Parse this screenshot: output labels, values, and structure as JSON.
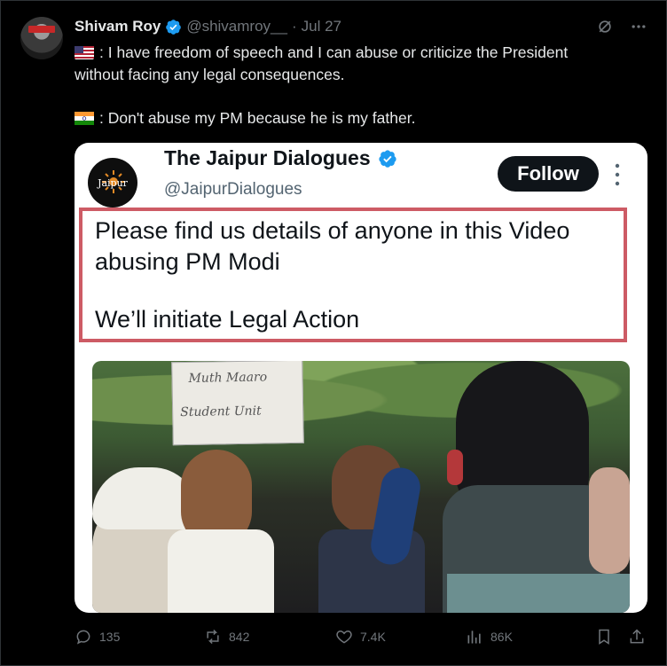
{
  "tweet": {
    "author_name": "Shivam Roy",
    "handle": "@shivamroy__",
    "separator": "·",
    "date": "Jul 27",
    "line1": ": I have freedom of speech and I can abuse or criticize the President",
    "line2": "without facing any legal consequences.",
    "line3": ": Don't abuse my PM because he is my father.",
    "flag1_icon": "us-flag-icon",
    "flag2_icon": "india-flag-icon"
  },
  "quoted": {
    "name": "The Jaipur Dialogues",
    "handle": "@JaipurDialogues",
    "follow_label": "Follow",
    "logo_text": "Jaipur",
    "text_line1": "Please find us details of anyone in this Video",
    "text_line2": "abusing PM Modi",
    "text_line3": "We’ll initiate Legal Action",
    "sign_line1": "Muth Maaro",
    "sign_line2": "Student Unit",
    "highlight_color": "#cd5b65"
  },
  "actions": {
    "replies": "135",
    "reposts": "842",
    "likes": "7.4K",
    "views": "86K"
  },
  "colors": {
    "background": "#000000",
    "muted": "#71767b",
    "verified": "#1d9bf0"
  }
}
